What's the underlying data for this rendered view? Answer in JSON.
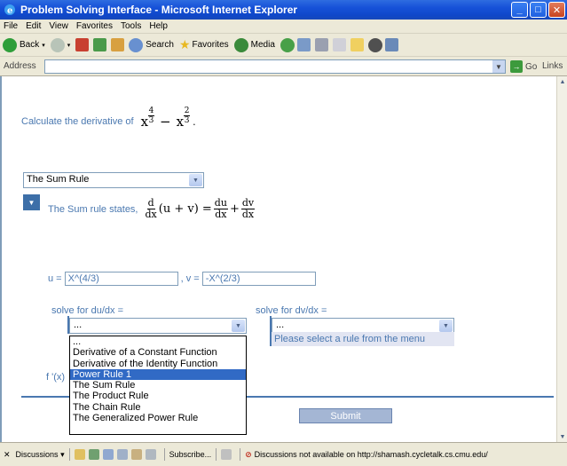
{
  "window": {
    "title": "Problem Solving Interface - Microsoft Internet Explorer"
  },
  "menu": {
    "items": [
      "File",
      "Edit",
      "View",
      "Favorites",
      "Tools",
      "Help"
    ]
  },
  "toolbar": {
    "back_label": "Back",
    "search_label": "Search",
    "favorites_label": "Favorites",
    "media_label": "Media"
  },
  "addressbar": {
    "label": "Address",
    "go_label": "Go",
    "links_label": "Links"
  },
  "problem": {
    "prompt": "Calculate the derivative of",
    "base1": "x",
    "exp1_num": "4",
    "exp1_den": "3",
    "minus": "−",
    "base2": "x",
    "exp2_num": "2",
    "exp2_den": "3",
    "period": "."
  },
  "rule_select": {
    "selected": "The Sum Rule"
  },
  "sum_rule": {
    "text": "The Sum rule states,",
    "d": "d",
    "dx": "dx",
    "paren": "(u + v) =",
    "du": "du",
    "plus": "+",
    "dv": "dv"
  },
  "assignments": {
    "u_label": "u =",
    "u_value": "X^(4/3)",
    "v_label": ", v =",
    "v_value": "-X^(2/3)"
  },
  "solve": {
    "du_label": "solve for du/dx =",
    "dv_label": "solve for dv/dx =",
    "du_selected": "...",
    "dv_selected": "...",
    "hint": "Please select a rule from the menu",
    "options": [
      "...",
      "Derivative of a Constant Function",
      "Derivative of the Identity Function",
      "Power Rule 1",
      "The Sum Rule",
      "The Product Rule",
      "The Chain Rule",
      "The Generalized Power Rule"
    ],
    "highlighted_index": 3
  },
  "result": {
    "fx_label": "f '(x)"
  },
  "submit": {
    "label": "Submit"
  },
  "statusbar": {
    "discussions_label": "Discussions",
    "subscribe_label": "Subscribe...",
    "message": "Discussions not available on http://shamash.cycletalk.cs.cmu.edu/"
  },
  "colors": {
    "accent_text": "#4A78B0",
    "title_bar": "#1651D8",
    "highlight": "#316AC5",
    "submit_bg": "#A4B6D4"
  }
}
